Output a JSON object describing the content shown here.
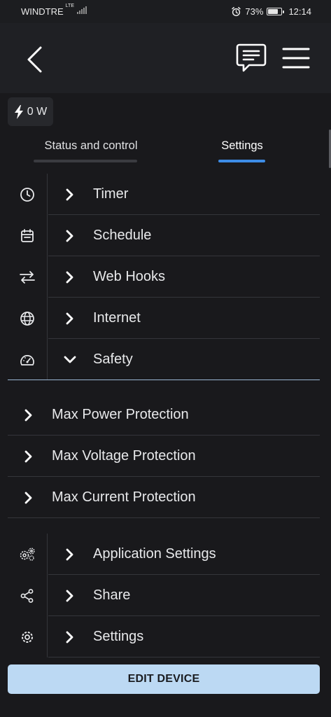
{
  "status_bar": {
    "carrier": "WINDTRE",
    "network": "LTE",
    "battery_percent": "73%",
    "battery_level": 0.73,
    "time": "12:14",
    "icons": [
      "alarm-icon",
      "battery-icon",
      "signal-icon"
    ]
  },
  "app_bar": {
    "icons": [
      "back-arrow-icon",
      "chat-message-icon",
      "hamburger-menu-icon"
    ]
  },
  "power_chip": {
    "icon": "lightning-bolt-icon",
    "value": "0 W"
  },
  "tabs": [
    {
      "label": "Status and control",
      "active": false
    },
    {
      "label": "Settings",
      "active": true
    }
  ],
  "settings_rows": [
    {
      "label": "Timer",
      "icon": "clock-icon"
    },
    {
      "label": "Schedule",
      "icon": "calendar-icon"
    },
    {
      "label": "Web Hooks",
      "icon": "swap-arrows-icon"
    },
    {
      "label": "Internet",
      "icon": "globe-icon"
    },
    {
      "label": "Safety",
      "icon": "gauge-icon",
      "expanded": true
    }
  ],
  "safety_subitems": [
    {
      "label": "Max Power Protection"
    },
    {
      "label": "Max Voltage Protection"
    },
    {
      "label": "Max Current Protection"
    }
  ],
  "settings_rows_2": [
    {
      "label": "Application Settings",
      "icon": "gears-icon"
    },
    {
      "label": "Share",
      "icon": "share-icon"
    },
    {
      "label": "Settings",
      "icon": "gear-icon"
    }
  ],
  "edit_button": {
    "label": "EDIT DEVICE"
  },
  "colors": {
    "accent": "#3d8ce6",
    "button_bg": "#bcd9f3",
    "background": "#19191c",
    "appbar": "#1f2024"
  }
}
